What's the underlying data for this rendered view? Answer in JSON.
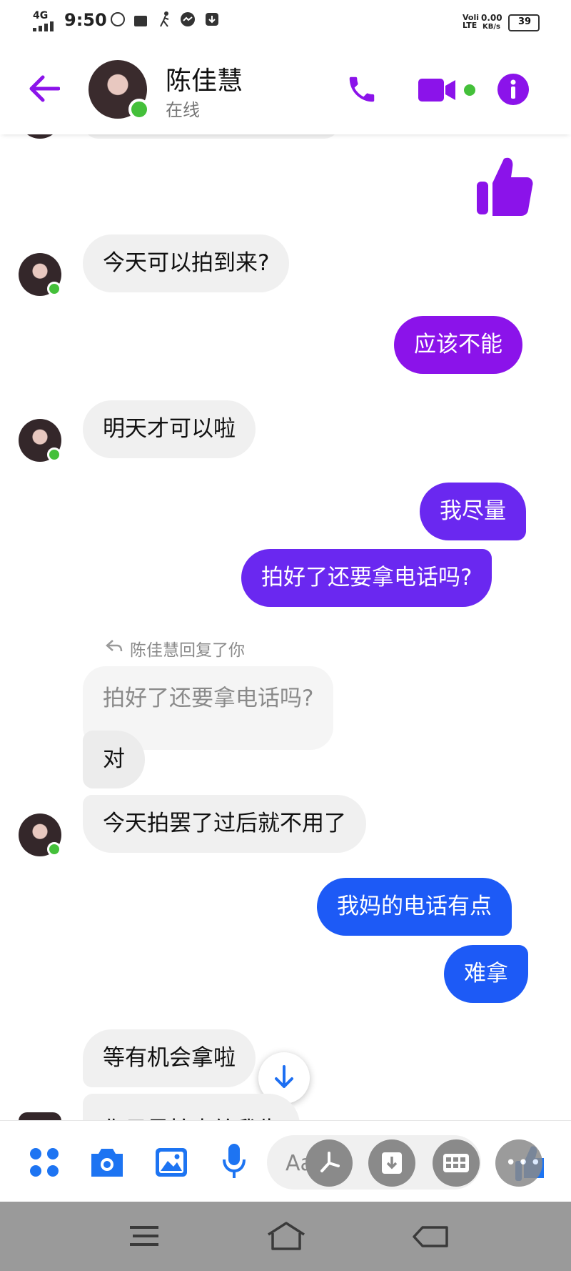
{
  "status_bar": {
    "network": "4G",
    "time": "9:50",
    "volte": "Voli LTE",
    "speed": "0.00",
    "speed_unit": "KB/s",
    "battery": "39"
  },
  "header": {
    "contact_name": "陈佳慧",
    "presence": "在线",
    "back_icon": "back-arrow-icon",
    "call_icon": "phone-icon",
    "video_icon": "video-camera-icon",
    "info_icon": "info-icon",
    "accent_color": "#8b13ea"
  },
  "messages": {
    "m1": "今天可以拍到来?",
    "m2": "应该不能",
    "m3": "明天才可以啦",
    "m4": "我尽量",
    "m5": "拍好了还要拿电话吗?",
    "reply_header": "陈佳慧回复了你",
    "quoted": "拍好了还要拿电话吗?",
    "m6": "对",
    "m7": "今天拍罢了过后就不用了",
    "m8": "我妈的电话有点",
    "m9": "难拿",
    "m10": "等有机会拿啦",
    "m11": "你只是拍点给我告"
  },
  "composer": {
    "placeholder": "Aa",
    "icons": [
      "apps-icon",
      "camera-icon",
      "gallery-icon",
      "microphone-icon",
      "emoji-icon",
      "like-icon"
    ]
  },
  "navigation": {
    "icons": [
      "menu-icon",
      "home-icon",
      "back-icon"
    ]
  }
}
